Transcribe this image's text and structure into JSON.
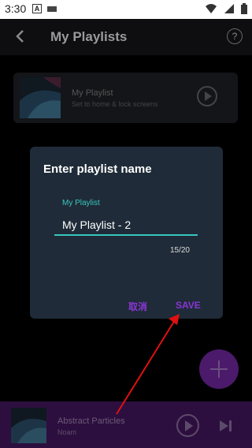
{
  "status_bar": {
    "time": "3:30",
    "a_badge": "A"
  },
  "header": {
    "title": "My Playlists",
    "help_icon": "?"
  },
  "playlist": {
    "name": "My Playlist",
    "subtitle": "Set to home & lock screens"
  },
  "dialog": {
    "title": "Enter playlist name",
    "field_label": "My Playlist",
    "field_value": "My Playlist - 2",
    "char_count": "15/20",
    "cancel_label": "取消",
    "save_label": "SAVE"
  },
  "player": {
    "track_title": "Abstract Particles",
    "artist": "Noam"
  },
  "colors": {
    "accent_teal": "#39c6c0",
    "accent_purple": "#8a35d6",
    "dialog_bg": "#1f2b38",
    "player_bg": "#2c0f3f",
    "annotation_red": "#e01010"
  }
}
